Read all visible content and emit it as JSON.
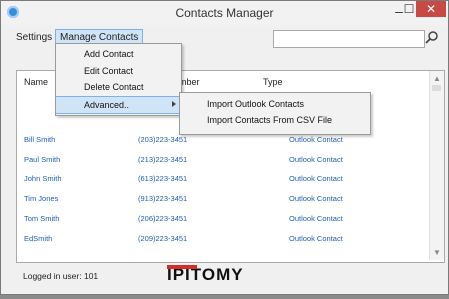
{
  "window": {
    "title": "Contacts Manager"
  },
  "menubar": {
    "settings": "Settings",
    "manage_contacts": "Manage Contacts"
  },
  "search": {
    "value": "",
    "placeholder": ""
  },
  "list": {
    "columns": {
      "name": "Name",
      "number": "umber",
      "type": "Type"
    },
    "rows": [
      {
        "name": "Bill Smith",
        "phone": "(203)223-3451",
        "type": "Outlook Contact"
      },
      {
        "name": "Paul Smith",
        "phone": "(213)223-3451",
        "type": "Outlook Contact"
      },
      {
        "name": "John Smith",
        "phone": "(613)223-3451",
        "type": "Outlook Contact"
      },
      {
        "name": "Tim Jones",
        "phone": "(913)223-3451",
        "type": "Outlook Contact"
      },
      {
        "name": "Tom Smith",
        "phone": "(206)223-3451",
        "type": "Outlook Contact"
      },
      {
        "name": "EdSmith",
        "phone": "(209)223-3451",
        "type": "Outlook Contact"
      }
    ]
  },
  "dropdown": {
    "items": [
      "Add Contact",
      "Edit Contact",
      "Delete Contact",
      "Advanced.."
    ]
  },
  "submenu": {
    "items": [
      "Import Outlook Contacts",
      "Import Contacts From CSV File"
    ]
  },
  "status": {
    "logged_in": "Logged in user: 101"
  },
  "logo": {
    "text": "IPITOMY"
  },
  "colors": {
    "accent": "#cfe5f7",
    "link": "#1f5fb5",
    "close": "#c74a45",
    "logo_red": "#d3302d"
  }
}
